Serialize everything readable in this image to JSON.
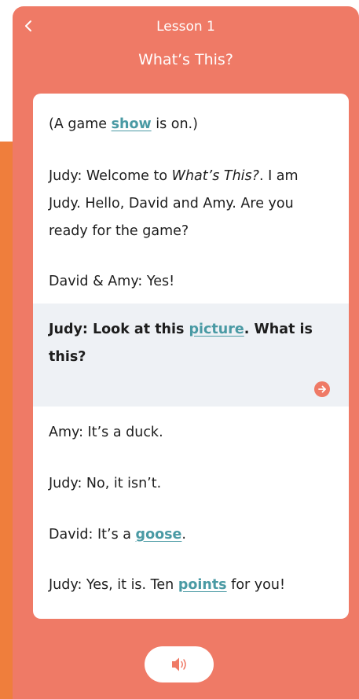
{
  "header": {
    "lesson": "Lesson 1",
    "title": "What’s This?"
  },
  "dialogue": {
    "l1": {
      "a": "(A game ",
      "w": "show",
      "b": " is on.)"
    },
    "l2": {
      "a": "Judy: Welcome to ",
      "i": "What’s This?",
      "b": ". I am Judy. Hello, David and Amy. Are you ready for the game?"
    },
    "l3": {
      "a": "David & Amy: Yes!"
    },
    "l4": {
      "a": "Judy: Look at this ",
      "w": "picture",
      "b": ". What is this?"
    },
    "l5": {
      "a": "Amy: It’s a duck."
    },
    "l6": {
      "a": "Judy: No, it isn’t."
    },
    "l7": {
      "a": "David: It’s a ",
      "w": "goose",
      "b": "."
    },
    "l8": {
      "a": "Judy: Yes, it is. Ten ",
      "w": "points",
      "b": " for you!"
    }
  },
  "icons": {
    "back": "chevron-left-icon",
    "next": "arrow-right-icon",
    "audio": "speaker-icon"
  },
  "colors": {
    "panel": "#ef7a66",
    "side": "#ef7e3c",
    "link": "#4a9aa4",
    "highlight": "#eef1f5"
  }
}
